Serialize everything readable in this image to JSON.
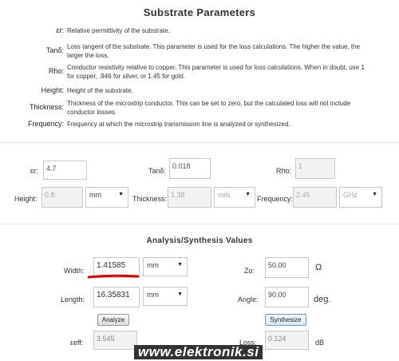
{
  "substrate": {
    "title": "Substrate Parameters",
    "definitions": [
      {
        "term": "εr:",
        "text": "Relative permittivity of the substrate."
      },
      {
        "term": "Tanδ:",
        "text": "Loss tangent of the substrate. This parameter is used for the loss calculations. The higher the value, the larger the loss."
      },
      {
        "term": "Rho:",
        "text": "Conductor resistivity relative to copper. This parameter is used for loss calculations. When in doubt, use 1 for copper, .946 for silver, or 1.45 for gold."
      },
      {
        "term": "Height:",
        "text": "Height of the substrate."
      },
      {
        "term": "Thickness:",
        "text": "Thickness of the microstrip conductor. This can be set to zero, but the calculated loss will not include conductor losses."
      },
      {
        "term": "Frequency:",
        "text": "Frequency at which the microstrip transmission line is analyzed or synthesized."
      }
    ],
    "er_label": "εr:",
    "er_value": "4.7",
    "tand_label": "Tanδ:",
    "tand_value": "0.018",
    "rho_label": "Rho:",
    "rho_value": "1",
    "height_label": "Height:",
    "height_value": "0.8",
    "height_unit": "mm",
    "thickness_label": "Thickness:",
    "thickness_value": "1.38",
    "thickness_unit": "mils",
    "frequency_label": "Frequency:",
    "frequency_value": "2.45",
    "frequency_unit": "GHz"
  },
  "analysis": {
    "title": "Analysis/Synthesis Values",
    "width_label": "Width:",
    "width_value": "1.41585",
    "width_unit": "mm",
    "length_label": "Length:",
    "length_value": "16.35831",
    "length_unit": "mm",
    "zo_label": "Zo:",
    "zo_value": "50.00",
    "zo_unit": "Ω",
    "angle_label": "Angle:",
    "angle_value": "90.00",
    "angle_unit": "deg.",
    "analyze_button": "Analyze",
    "synthesize_button": "Synthesize",
    "eeff_label": "εeff:",
    "eeff_value": "3.545",
    "loss_label": "Loss:",
    "loss_value": "0.124",
    "loss_unit": "dB"
  },
  "watermark": "www.elektronik.si",
  "colors": {
    "highlight_underline": "#e00000",
    "button_blue_border": "#6a9bd8"
  }
}
